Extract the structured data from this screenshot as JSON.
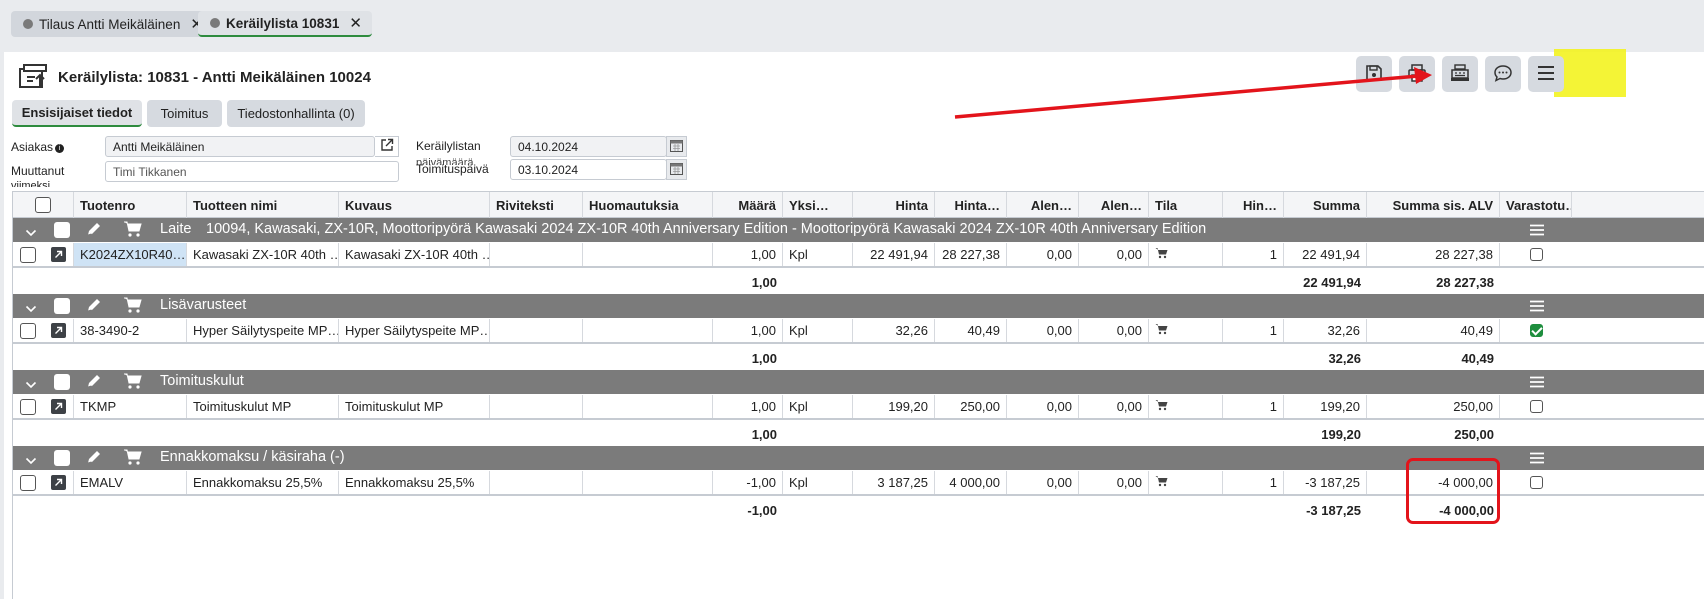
{
  "tabs": [
    {
      "label": "Tilaus Antti Meikäläinen",
      "active": false
    },
    {
      "label": "Keräilylista 10831",
      "active": true
    }
  ],
  "header": {
    "title": "Keräilylista: 10831 - Antti Meikäläinen 10024"
  },
  "toolbar": {
    "icons": [
      "save-icon",
      "print-icon",
      "cash-register-icon",
      "comment-icon",
      "menu-icon"
    ]
  },
  "subtabs": [
    "Ensisijaiset tiedot",
    "Toimitus",
    "Tiedostonhallinta (0)"
  ],
  "form": {
    "asiakas_label": "Asiakas",
    "asiakas_value": "Antti Meikäläinen",
    "muuttanut_label": "Muuttanut",
    "muuttanut_placeholder": "Timi Tikkanen",
    "muuttanut_overflow": "viimeksi",
    "keraily_date_label": "Keräilylistan",
    "keraily_date_label2": "päivämäärä",
    "keraily_date": "04.10.2024",
    "toimitus_date_label": "Toimituspäivä",
    "toimitus_date": "03.10.2024"
  },
  "grid": {
    "columns": [
      "Tuotenro",
      "Tuotteen nimi",
      "Kuvaus",
      "Riviteksti",
      "Huomautuksia",
      "Määrä",
      "Yksi…",
      "Hinta",
      "Hinta…",
      "Alen…",
      "Alen…",
      "Tila",
      "Hin…",
      "Summa",
      "Summa sis. ALV",
      "Varastotu…"
    ],
    "groups": [
      {
        "name": "Laite",
        "description": "10094, Kawasaki, ZX-10R, Moottoripyörä Kawasaki 2024 ZX-10R 40th Anniversary Edition - Moottoripyörä Kawasaki 2024 ZX-10R 40th Anniversary Edition",
        "row": {
          "tuotenro": "K2024ZX10R40…",
          "nimi": "Kawasaki ZX-10R 40th …",
          "kuvaus": "Kawasaki ZX-10R 40th …",
          "riviteksti": "",
          "huomautuksia": "",
          "maara": "1,00",
          "yksikko": "Kpl",
          "hinta": "22 491,94",
          "hinta2": "28 227,38",
          "ale1": "0,00",
          "ale2": "0,00",
          "hin": "1",
          "summa": "22 491,94",
          "summa_alv": "28 227,38",
          "varastossa": false
        },
        "total": {
          "maara": "1,00",
          "summa": "22 491,94",
          "summa_alv": "28 227,38"
        }
      },
      {
        "name": "Lisävarusteet",
        "description": "",
        "row": {
          "tuotenro": "38-3490-2",
          "nimi": "Hyper Säilytyspeite MP…",
          "kuvaus": "Hyper Säilytyspeite MP…",
          "riviteksti": "",
          "huomautuksia": "",
          "maara": "1,00",
          "yksikko": "Kpl",
          "hinta": "32,26",
          "hinta2": "40,49",
          "ale1": "0,00",
          "ale2": "0,00",
          "hin": "1",
          "summa": "32,26",
          "summa_alv": "40,49",
          "varastossa": true
        },
        "total": {
          "maara": "1,00",
          "summa": "32,26",
          "summa_alv": "40,49"
        }
      },
      {
        "name": "Toimituskulut",
        "description": "",
        "row": {
          "tuotenro": "TKMP",
          "nimi": "Toimituskulut MP",
          "kuvaus": "Toimituskulut MP",
          "riviteksti": "",
          "huomautuksia": "",
          "maara": "1,00",
          "yksikko": "Kpl",
          "hinta": "199,20",
          "hinta2": "250,00",
          "ale1": "0,00",
          "ale2": "0,00",
          "hin": "1",
          "summa": "199,20",
          "summa_alv": "250,00",
          "varastossa": false
        },
        "total": {
          "maara": "1,00",
          "summa": "199,20",
          "summa_alv": "250,00"
        }
      },
      {
        "name": "Ennakkomaksu / käsiraha (-)",
        "description": "",
        "row": {
          "tuotenro": "EMALV",
          "nimi": "Ennakkomaksu 25,5%",
          "kuvaus": "Ennakkomaksu 25,5%",
          "riviteksti": "",
          "huomautuksia": "",
          "maara": "-1,00",
          "yksikko": "Kpl",
          "hinta": "3 187,25",
          "hinta2": "4 000,00",
          "ale1": "0,00",
          "ale2": "0,00",
          "hin": "1",
          "summa": "-3 187,25",
          "summa_alv": "-4 000,00",
          "varastossa": false
        },
        "total": {
          "maara": "-1,00",
          "summa": "-3 187,25",
          "summa_alv": "-4 000,00"
        }
      }
    ]
  },
  "colors": {
    "accent": "#2e8b3e",
    "group_bg": "#7b7b7b",
    "annotation_red": "#e3141b",
    "highlight": "#f2f21a"
  }
}
